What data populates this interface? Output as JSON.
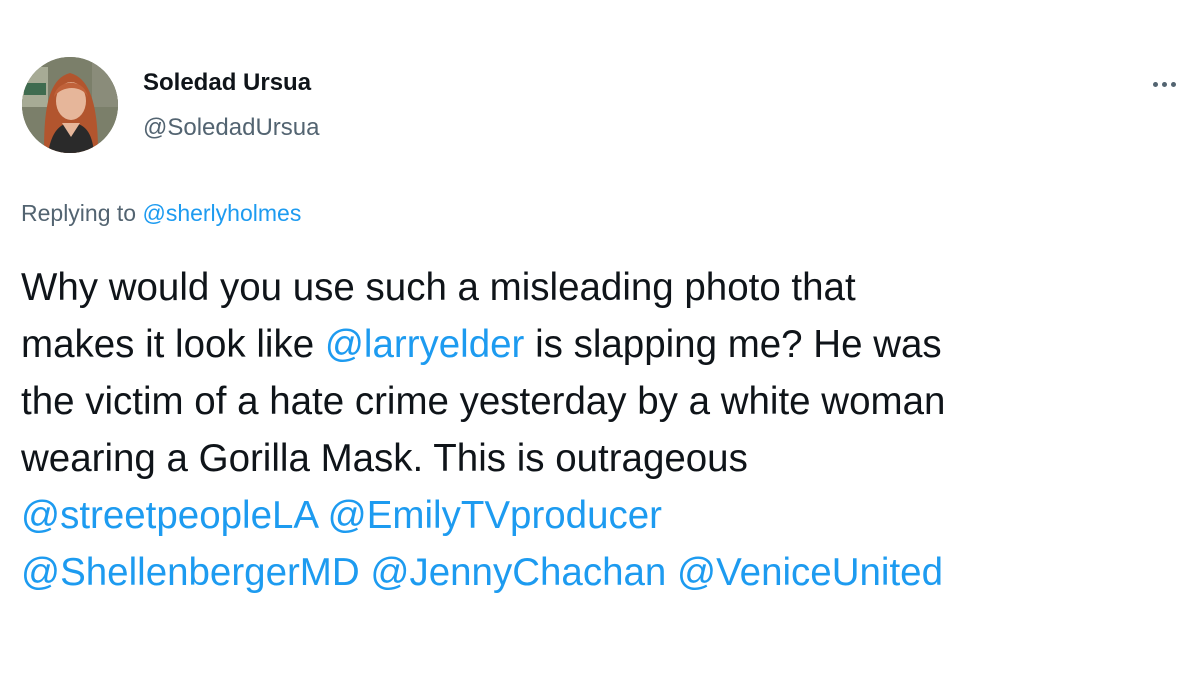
{
  "tweet": {
    "author": {
      "display_name": "Soledad Ursua",
      "handle": "@SoledadUrsua",
      "avatar_icon": "profile-photo"
    },
    "more_icon": "more-horizontal-icon",
    "reply_context": {
      "prefix": "Replying to ",
      "mention": "@sherlyholmes"
    },
    "text": {
      "line1": "Why would you use such a misleading photo that",
      "line2_before": "makes it look like ",
      "line2_mention": "@larryelder",
      "line2_after": " is slapping me? He was",
      "line3": "the victim of a hate crime yesterday by a white woman",
      "line4": "wearing a Gorilla Mask. This is outrageous",
      "mentions_row1": [
        "@streetpeopleLA",
        "@EmilyTVproducer"
      ],
      "mentions_row2": [
        "@ShellenbergerMD",
        "@JennyChachan",
        "@VeniceUnited"
      ]
    },
    "colors": {
      "link": "#1d9bf0",
      "text": "#0f1419",
      "secondary": "#536471"
    }
  }
}
